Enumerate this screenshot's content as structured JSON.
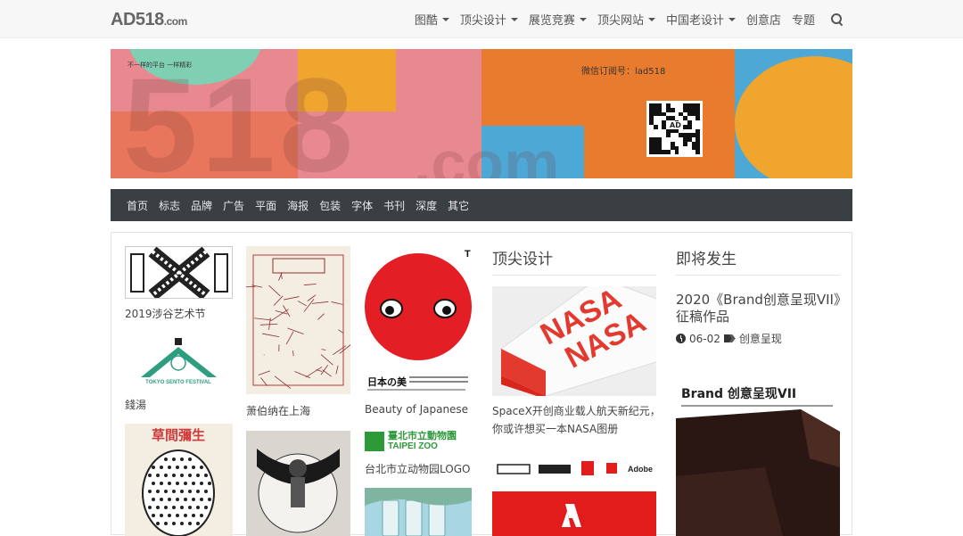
{
  "site": {
    "logo_main": "AD518",
    "logo_suffix": ".com"
  },
  "nav": {
    "items": [
      {
        "label": "图酷",
        "dropdown": true
      },
      {
        "label": "顶尖设计",
        "dropdown": true
      },
      {
        "label": "展览竞赛",
        "dropdown": true
      },
      {
        "label": "顶尖网站",
        "dropdown": true
      },
      {
        "label": "中国老设计",
        "dropdown": true
      },
      {
        "label": "创意店",
        "dropdown": false
      },
      {
        "label": "专题",
        "dropdown": false
      }
    ],
    "search_icon": "search-icon"
  },
  "banner": {
    "big_text": "518",
    "com_text": ".com",
    "slogan": "不一样的平台 一样精彩",
    "wechat": "微信订阅号：lad518",
    "qr_label": "AD"
  },
  "categories": [
    "首页",
    "标志",
    "品牌",
    "广告",
    "平面",
    "海报",
    "包装",
    "字体",
    "书刊",
    "深度",
    "其它"
  ],
  "gallery": {
    "col1": [
      "2019涉谷艺术节",
      "錢湯"
    ],
    "col2": [
      "萧伯纳在上海"
    ],
    "col3": [
      "Beauty of Japanese",
      "台北市立动物园LOGO"
    ],
    "poster_japan": "日本の美",
    "poster_kusama": "草間彌生",
    "zoo_logo_cn": "臺北市立動物園",
    "zoo_logo_en": "TAIPEI ZOO",
    "sento_text": "TOKYO SENTO FESTIVAL"
  },
  "top_design": {
    "title": "顶尖设计",
    "article_desc": "SpaceX开创商业载人航天新纪元，你或许想买一本NASA图册",
    "adobe_label": "Adobe"
  },
  "upcoming": {
    "title": "即将发生",
    "article_title": "2020《Brand创意呈现VII》征稿作品",
    "date": "06-02",
    "tag": "创意呈现",
    "poster_text": "Brand 创意呈现VII"
  },
  "colors": {
    "topbar_bg": "#f7f7f8",
    "catnav_bg": "#3a3f44",
    "banner_pink": "#e8898f",
    "banner_orange": "#e87b2e",
    "banner_blue": "#4ea8d6",
    "banner_yellow": "#efa52e",
    "banner_green": "#7fcfb3"
  }
}
